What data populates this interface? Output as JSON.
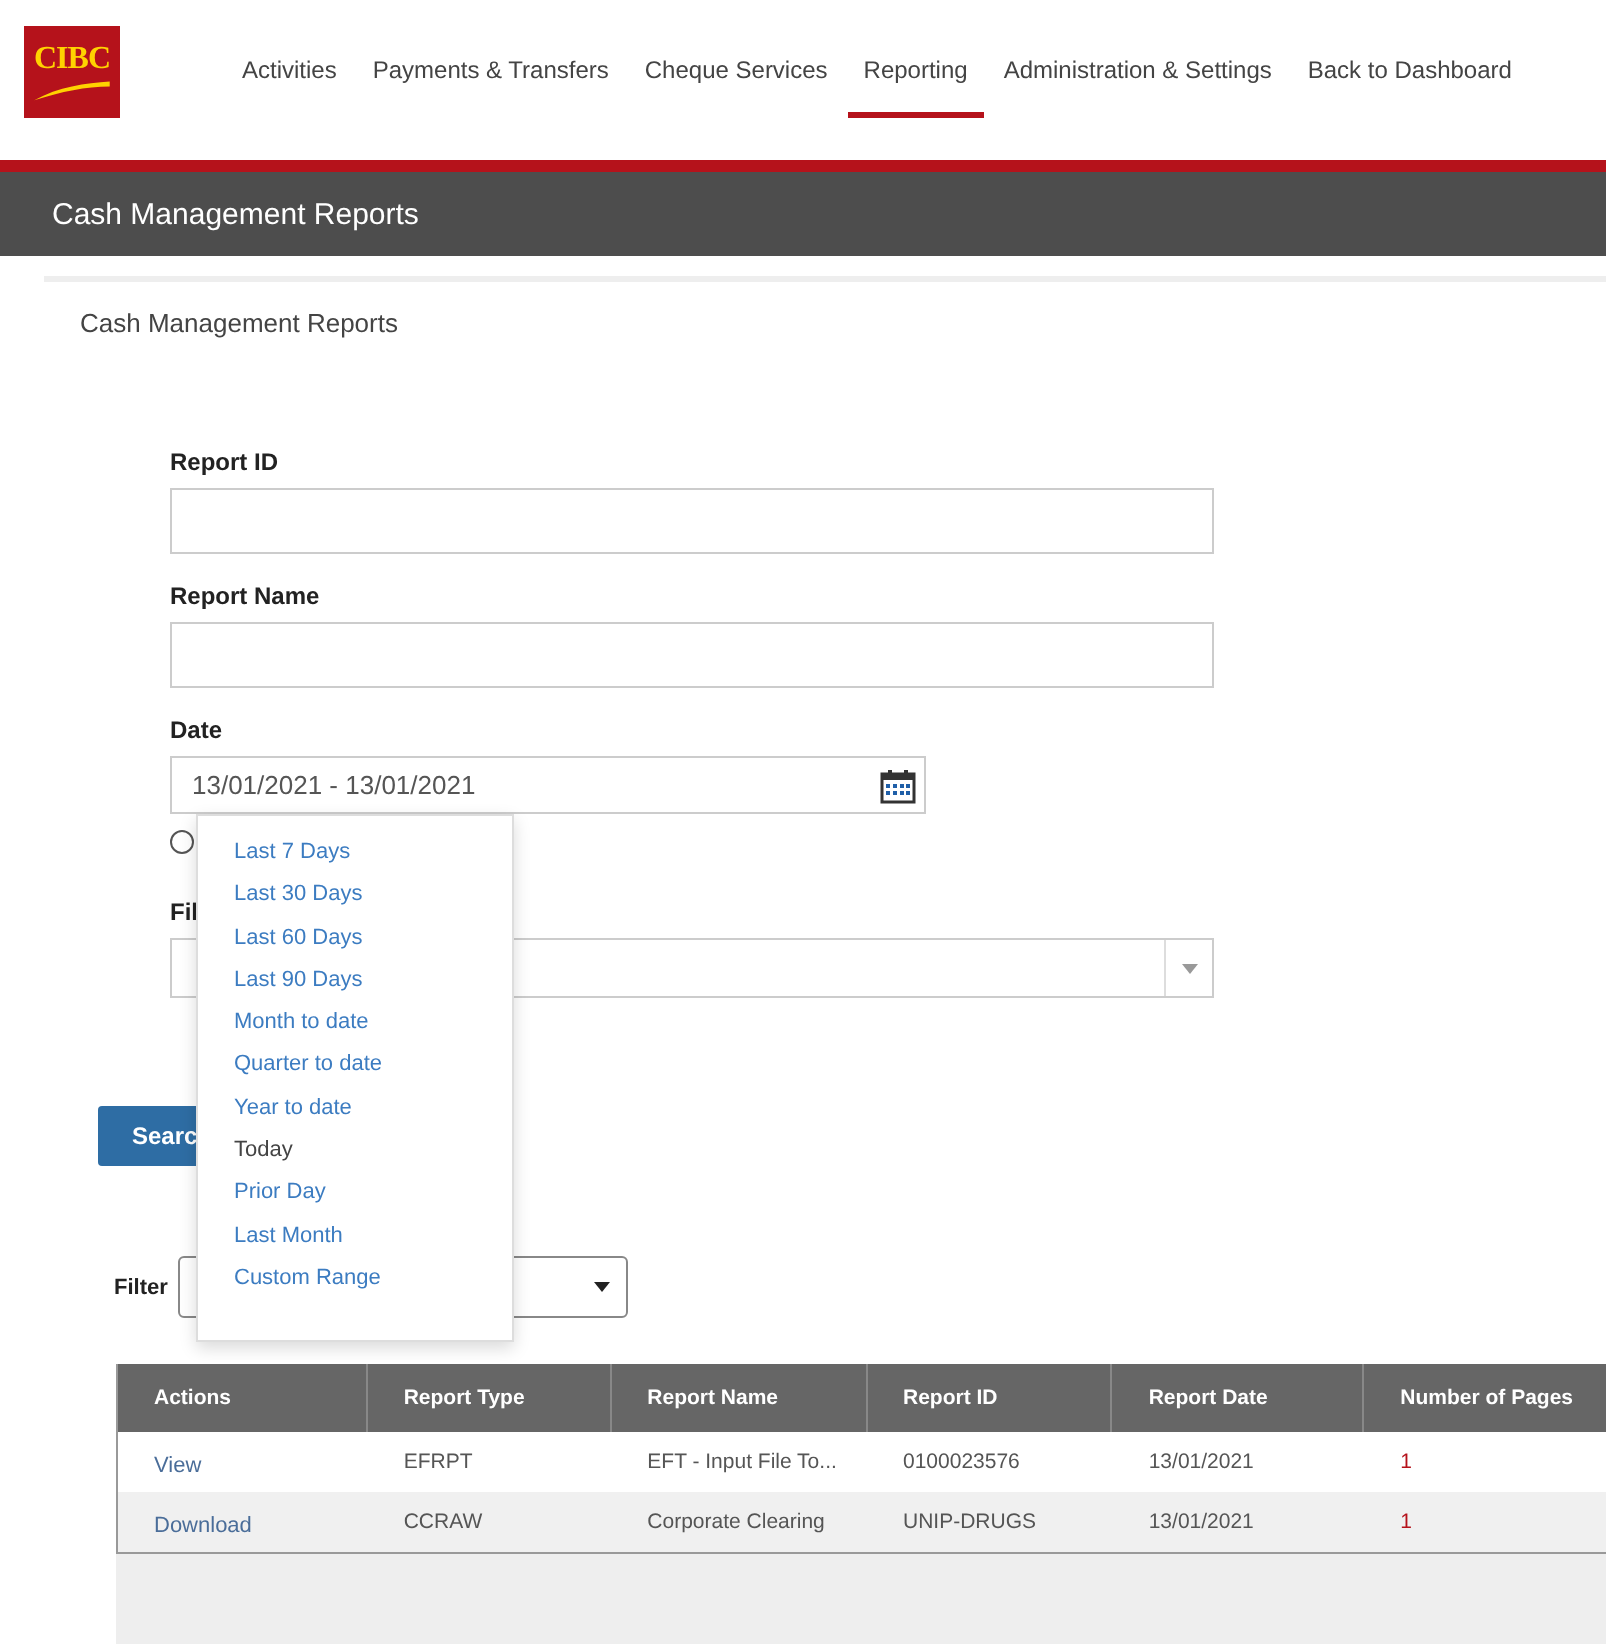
{
  "logo": "CIBC",
  "nav": [
    {
      "label": "Activities",
      "selected": false
    },
    {
      "label": "Payments & Transfers",
      "selected": false
    },
    {
      "label": "Cheque Services",
      "selected": false
    },
    {
      "label": "Reporting",
      "selected": true
    },
    {
      "label": "Administration & Settings",
      "selected": false
    },
    {
      "label": "Back to Dashboard",
      "selected": false
    }
  ],
  "page_header": {
    "title": "Cash Management Reports"
  },
  "breadcrumb": "Cash Management Reports",
  "form": {
    "fields": [
      {
        "label": "Report ID",
        "kind": "text"
      },
      {
        "label": "Report Name",
        "kind": "text"
      },
      {
        "label": "Date",
        "kind": "date",
        "value": "13/01/2021 - 13/01/2021"
      },
      {
        "label": "Fil",
        "kind": "select"
      }
    ],
    "radio": {
      "checked": false
    },
    "search_button": "Searc"
  },
  "date_menu": {
    "items": [
      {
        "label": "Last 7 Days",
        "selected": false
      },
      {
        "label": "Last 30 Days",
        "selected": false
      },
      {
        "label": "Last 60 Days",
        "selected": false
      },
      {
        "label": "Last 90 Days",
        "selected": false
      },
      {
        "label": "Month to date",
        "selected": false
      },
      {
        "label": "Quarter to date",
        "selected": false
      },
      {
        "label": "Year to date",
        "selected": false
      },
      {
        "label": "Today",
        "selected": true
      },
      {
        "label": "Prior Day",
        "selected": false
      },
      {
        "label": "Last Month",
        "selected": false
      },
      {
        "label": "Custom Range",
        "selected": false
      }
    ]
  },
  "filter": {
    "label": "Filter"
  },
  "table": {
    "columns": [
      "Actions",
      "Report Type",
      "Report Name",
      "Report ID",
      "Report Date",
      "Number of Pages"
    ],
    "rows": [
      {
        "cells": [
          "View",
          "EFRPT",
          "EFT - Input File To...",
          "0100023576",
          "13/01/2021",
          "1"
        ]
      },
      {
        "cells": [
          "Download",
          "CCRAW",
          "Corporate Clearing",
          "UNIP-DRUGS",
          "13/01/2021",
          "1"
        ]
      }
    ]
  }
}
